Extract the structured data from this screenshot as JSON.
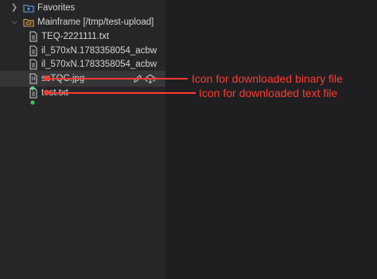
{
  "sidebar": {
    "favorites": {
      "label": "Favorites",
      "icon": "folder-star-icon"
    },
    "server": {
      "label": "Mainframe [/tmp/test-upload]",
      "icon": "server-folder-icon"
    },
    "files": [
      {
        "name": "TEQ-2221111.txt",
        "icon": "text-file-icon"
      },
      {
        "name": "il_570xN.1783358054_acbw",
        "icon": "text-file-icon"
      },
      {
        "name": "il_570xN.1783358054_acbw",
        "icon": "text-file-icon"
      },
      {
        "name": "ssTQC.jpg",
        "icon": "binary-file-icon",
        "badge": "downloaded",
        "selected": true
      },
      {
        "name": "test.txt",
        "icon": "text-file-icon",
        "badge": "downloaded"
      }
    ]
  },
  "annotations": {
    "binary": "Icon for downloaded binary file",
    "text": "Icon for downloaded text file"
  },
  "colors": {
    "sidebar_bg": "#262628",
    "main_bg": "#1f1f21",
    "selected_row": "#363638",
    "annotation": "#ff3b30",
    "downloaded_badge": "#34c759"
  }
}
